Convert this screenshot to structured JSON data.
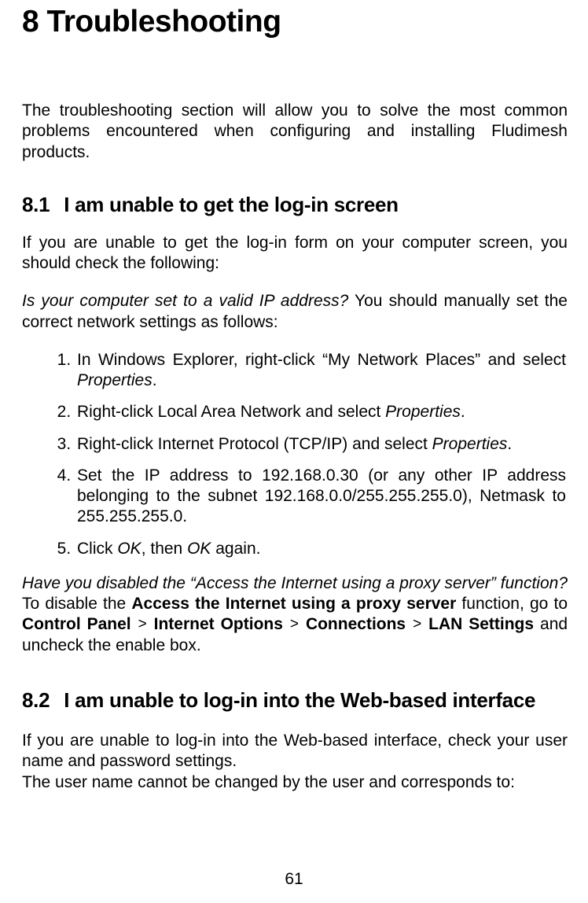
{
  "chapter": {
    "number": "8",
    "title": "Troubleshooting",
    "intro": "The troubleshooting section will allow you to solve the most common problems encountered when configuring and installing Fludimesh products."
  },
  "section_8_1": {
    "number": "8.1",
    "title": "I am unable to get the log-in screen",
    "lead": "If you are unable to get the log-in form on your computer screen, you should check the following:",
    "q1_italic": "Is your computer set to a valid IP address?",
    "q1_rest": " You should manually set the correct network settings as follows:",
    "steps": {
      "s1a": "In Windows Explorer, right-click “My Network Places” and select ",
      "s1b": "Properties",
      "s1c": ".",
      "s2a": "Right-click Local Area Network and select ",
      "s2b": "Properties",
      "s2c": ".",
      "s3a": "Right-click Internet Protocol (TCP/IP) and select ",
      "s3b": "Properties",
      "s3c": ".",
      "s4": "Set the IP address to 192.168.0.30 (or any other IP address belonging to the subnet 192.168.0.0/255.255.255.0), Netmask to 255.255.255.0.",
      "s5a": "Click ",
      "s5b": "OK",
      "s5c": ", then ",
      "s5d": "OK",
      "s5e": " again."
    },
    "q2_italic": "Have you disabled the “Access the Internet using a proxy server” function?",
    "p_after_q2_a": "To disable the ",
    "p_after_q2_b": "Access the Internet using a proxy server",
    "p_after_q2_c": " function, go to ",
    "path1": "Control Panel",
    "path2": "Internet Options",
    "path3": "Connections",
    "path4": "LAN Settings",
    "p_after_q2_d": " and uncheck the enable box."
  },
  "section_8_2": {
    "number": "8.2",
    "title": "I am unable to log-in into the Web-based interface",
    "p1": "If you are unable to log-in into the Web-based interface, check your user name and password settings.",
    "p2": "The user name cannot be changed by the user and corresponds to:"
  },
  "page_number": "61",
  "symbols": {
    "gt": ">"
  }
}
